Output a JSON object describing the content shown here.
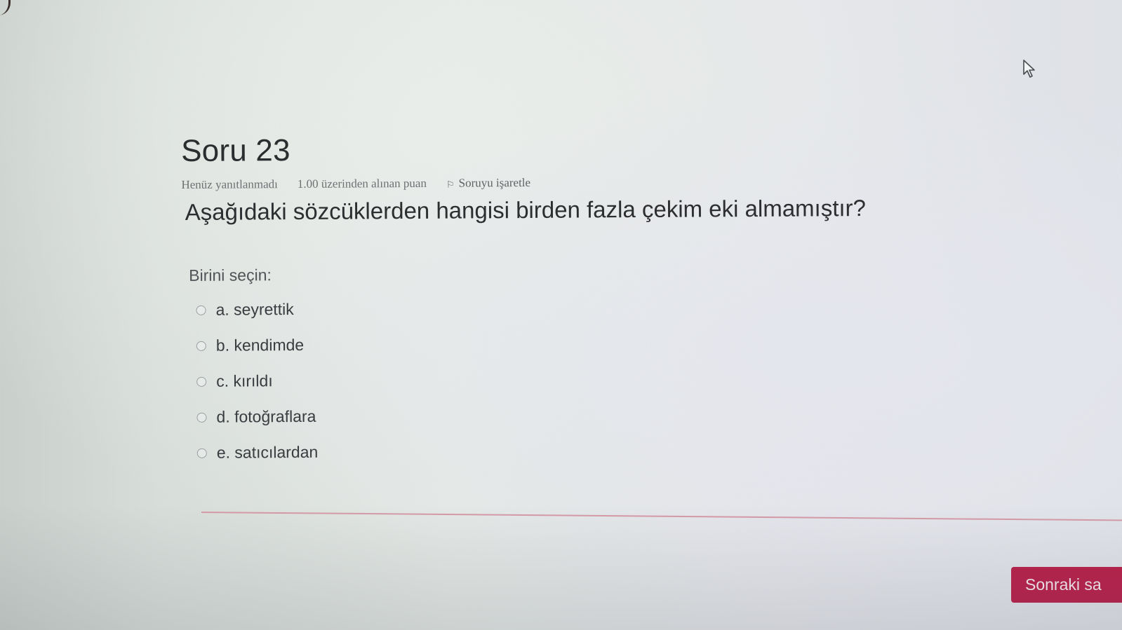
{
  "question": {
    "title": "Soru 23",
    "status": "Henüz yanıtlanmadı",
    "grade": "1.00 üzerinden alınan puan",
    "flag_label": "Soruyu işaretle",
    "text": "Aşağıdaki sözcüklerden hangisi birden fazla çekim eki almamıştır?",
    "prompt": "Birini seçin:",
    "options": [
      {
        "label": "a. seyrettik"
      },
      {
        "label": "b. kendimde"
      },
      {
        "label": "c. kırıldı"
      },
      {
        "label": "d. fotoğraflara"
      },
      {
        "label": "e. satıcılardan"
      }
    ]
  },
  "navigation": {
    "next_label": "Sonraki sa"
  },
  "colors": {
    "accent": "#b8204a",
    "divider": "#d59aa8"
  },
  "icons": {
    "flag": "flag-icon",
    "cursor": "mouse-pointer-icon",
    "radio": "radio-button"
  }
}
